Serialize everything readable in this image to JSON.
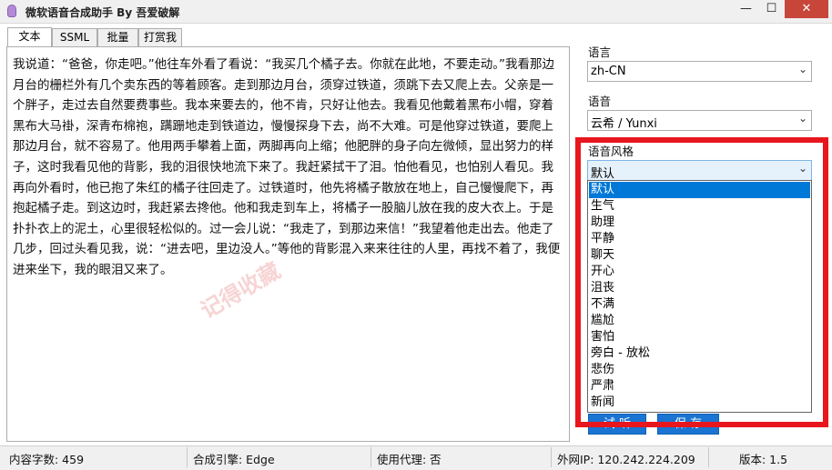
{
  "window": {
    "title": "微软语音合成助手 By 吾爱破解",
    "min_glyph": "—",
    "max_glyph": "☐",
    "close_glyph": "✕"
  },
  "tabs": [
    {
      "label": "文本",
      "active": true
    },
    {
      "label": "SSML",
      "active": false
    },
    {
      "label": "批量",
      "active": false
    },
    {
      "label": "打赏我",
      "active": false
    }
  ],
  "editor": {
    "text": "我说道：“爸爸，你走吧。”他往车外看了看说：“我买几个橘子去。你就在此地，不要走动。”我看那边月台的栅栏外有几个卖东西的等着顾客。走到那边月台，须穿过铁道，须跳下去又爬上去。父亲是一个胖子，走过去自然要费事些。我本来要去的，他不肯，只好让他去。我看见他戴着黑布小帽，穿着黑布大马褂，深青布棉袍，蹒跚地走到铁道边，慢慢探身下去，尚不大难。可是他穿过铁道，要爬上那边月台，就不容易了。他用两手攀着上面，两脚再向上缩；他肥胖的身子向左微倾，显出努力的样子，这时我看见他的背影，我的泪很快地流下来了。我赶紧拭干了泪。怕他看见，也怕别人看见。我再向外看时，他已抱了朱红的橘子往回走了。过铁道时，他先将橘子散放在地上，自己慢慢爬下，再抱起橘子走。到这边时，我赶紧去搀他。他和我走到车上，将橘子一股脑儿放在我的皮大衣上。于是扑扑衣上的泥土，心里很轻松似的。过一会儿说：“我走了，到那边来信！”我望着他走出去。他走了几步，回过头看见我，说：“进去吧，里边没人。”等他的背影混入来来往往的人里，再找不着了，我便进来坐下，我的眼泪又来了。",
    "watermark": "记得收藏"
  },
  "settings": {
    "language_label": "语言",
    "language_value": "zh-CN",
    "voice_label": "语音",
    "voice_value": "云希 / Yunxi",
    "style_label": "语音风格",
    "style_value": "默认",
    "style_options": [
      "默认",
      "生气",
      "助理",
      "平静",
      "聊天",
      "开心",
      "沮丧",
      "不满",
      "尴尬",
      "害怕",
      "旁白 - 放松",
      "悲伤",
      "严肃",
      "新闻"
    ],
    "selected_index": 0
  },
  "actions": {
    "test_label": "试 听",
    "save_label": "保 存"
  },
  "status": {
    "char_count": "内容字数: 459",
    "engine": "合成引擎: Edge",
    "proxy": "使用代理: 否",
    "ip": "外网IP: 120.242.224.209",
    "version": "版本: 1.5"
  },
  "colors": {
    "highlight": "#e8161d",
    "selection": "#0078d7",
    "button": "#1a74d2"
  }
}
